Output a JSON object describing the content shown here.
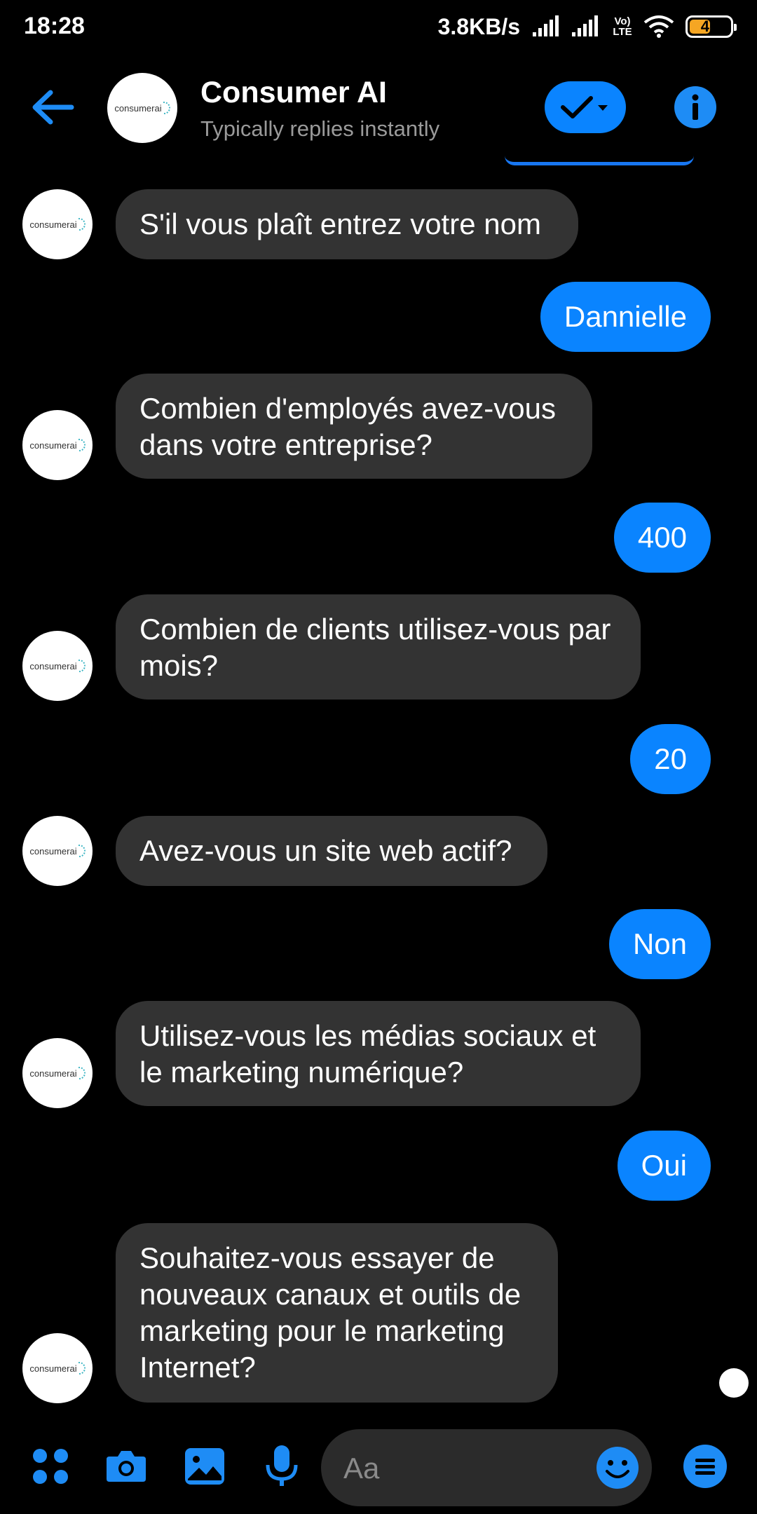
{
  "status_bar": {
    "time": "18:28",
    "net_speed": "3.8KB/s",
    "volte_line1": "Vo)",
    "volte_line2": "LTE",
    "battery": "47"
  },
  "header": {
    "title": "Consumer AI",
    "subtitle": "Typically replies instantly"
  },
  "logo_text": "consumerai",
  "messages": [
    {
      "from": "bot",
      "text": "S'il vous plaît entrez votre nom"
    },
    {
      "from": "user",
      "text": "Dannielle"
    },
    {
      "from": "bot",
      "text": "Combien d'employés avez-vous dans votre entreprise?"
    },
    {
      "from": "user",
      "text": "400"
    },
    {
      "from": "bot",
      "text": "Combien de clients utilisez-vous par mois?"
    },
    {
      "from": "user",
      "text": "20"
    },
    {
      "from": "bot",
      "text": "Avez-vous un site web actif?"
    },
    {
      "from": "user",
      "text": "Non"
    },
    {
      "from": "bot",
      "text": "Utilisez-vous les médias sociaux et le marketing numérique?"
    },
    {
      "from": "user",
      "text": "Oui"
    },
    {
      "from": "bot",
      "text": "Souhaitez-vous essayer de nouveaux canaux et outils de marketing pour le marketing Internet?"
    }
  ],
  "composer": {
    "placeholder": "Aa"
  },
  "colors": {
    "accent": "#0a84ff",
    "incoming_bubble": "#333333",
    "background": "#000000"
  },
  "icons": [
    "back-arrow-icon",
    "checkmark-icon",
    "info-icon",
    "apps-icon",
    "camera-icon",
    "gallery-icon",
    "microphone-icon",
    "emoji-icon",
    "menu-icon"
  ]
}
